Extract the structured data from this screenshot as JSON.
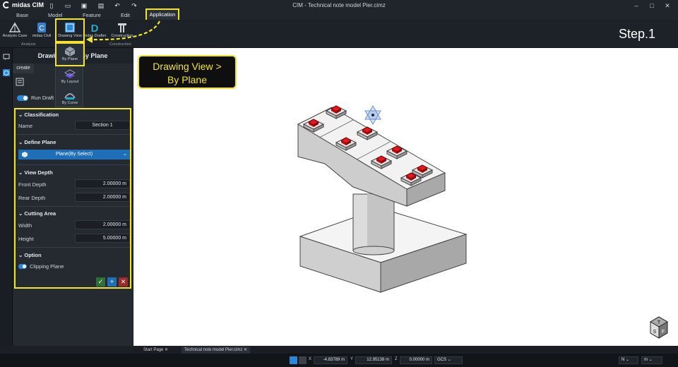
{
  "app": {
    "name": "midas CIM",
    "title": "CIM - Technical note model Pier.cimz"
  },
  "menu": [
    "Base",
    "Model",
    "Feature",
    "Edit",
    "Application"
  ],
  "ribbon": {
    "buttons": [
      "Analysis Case",
      "midas Civil",
      "Drawing View",
      "midas Drafter",
      "Construction"
    ],
    "groups": [
      "Analysis",
      "Construction"
    ]
  },
  "step_label": "Step.1",
  "dropdown": {
    "items": [
      "By Plane",
      "By Layout",
      "By Curve"
    ]
  },
  "panel": {
    "title": "Drawing View By Plane",
    "tab": "create",
    "run_draft": "Run Draft",
    "classification": {
      "header": "Classification",
      "name_label": "Name",
      "name_value": "Section 1"
    },
    "define_plane": {
      "header": "Define Plane",
      "select_value": "Plane(By Select)"
    },
    "view_depth": {
      "header": "View Depth",
      "front_label": "Front Depth",
      "front_value": "2.00000 m",
      "rear_label": "Rear Depth",
      "rear_value": "2.00000 m"
    },
    "cutting_area": {
      "header": "Cutting Area",
      "width_label": "Width",
      "width_value": "2.00000 m",
      "height_label": "Height",
      "height_value": "5.00000 m"
    },
    "option": {
      "header": "Option",
      "clipping_label": "Clipping Plane"
    }
  },
  "callout": {
    "line1": "Drawing View >",
    "line2": "By Plane"
  },
  "doc_tabs": [
    "Start Page",
    "Technical note model Pier.cimz"
  ],
  "status": {
    "x_label": "X",
    "x_value": "-4.83789 m",
    "y_label": "Y",
    "y_value": "12.95138 m",
    "z_label": "Z",
    "z_value": "0.00000 m",
    "coord_sys": "GCS",
    "unit_force": "N",
    "unit_length": "m"
  },
  "colors": {
    "accent_yellow": "#f2e32b",
    "accent_blue": "#2b88d8",
    "pad_red": "#e8171b"
  }
}
